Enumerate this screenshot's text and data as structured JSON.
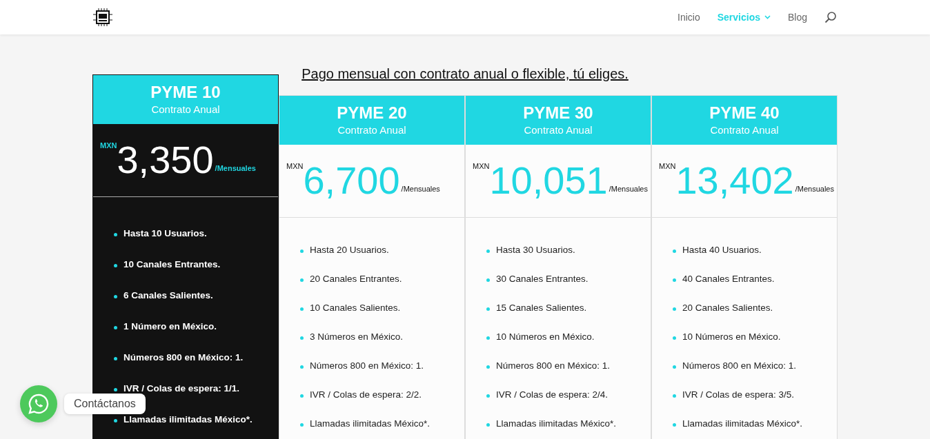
{
  "nav": {
    "items": [
      {
        "label": "Inicio",
        "selected": false,
        "has_menu": false
      },
      {
        "label": "Servicios",
        "selected": true,
        "has_menu": true
      },
      {
        "label": "Blog",
        "selected": false,
        "has_menu": false
      }
    ]
  },
  "heading": "Pago mensual con contrato anual o flexible, tú eliges.",
  "plans": [
    {
      "name": "PYME 10",
      "term": "Contrato Anual",
      "featured": true,
      "currency": "MXN",
      "price": "3,350",
      "period": "/Mensuales",
      "features": [
        "Hasta 10 Usuarios.",
        "10 Canales Entrantes.",
        "6 Canales Salientes.",
        "1 Número en México.",
        "Números 800 en México: 1.",
        "IVR / Colas de espera: 1/1.",
        "Llamadas ilimitadas México*."
      ]
    },
    {
      "name": "PYME 20",
      "term": "Contrato Anual",
      "featured": false,
      "currency": "MXN",
      "price": "6,700",
      "period": "/Mensuales",
      "features": [
        "Hasta 20 Usuarios.",
        "20 Canales Entrantes.",
        "10 Canales Salientes.",
        "3 Números en México.",
        "Números 800 en México: 1.",
        "IVR / Colas de espera: 2/2.",
        "Llamadas ilimitadas México*."
      ]
    },
    {
      "name": "PYME 30",
      "term": "Contrato Anual",
      "featured": false,
      "currency": "MXN",
      "price": "10,051",
      "period": "/Mensuales",
      "features": [
        "Hasta 30 Usuarios.",
        "30 Canales Entrantes.",
        "15 Canales Salientes.",
        "10 Números en México.",
        "Números 800 en México: 1.",
        "IVR / Colas de espera: 2/4.",
        "Llamadas ilimitadas México*."
      ]
    },
    {
      "name": "PYME 40",
      "term": "Contrato Anual",
      "featured": false,
      "currency": "MXN",
      "price": "13,402",
      "period": "/Mensuales",
      "features": [
        "Hasta 40 Usuarios.",
        "40 Canales Entrantes.",
        "20 Canales Salientes.",
        "10 Números en México.",
        "Números 800 en México: 1.",
        "IVR / Colas de espera: 3/5.",
        "Llamadas ilimitadas México*."
      ]
    }
  ],
  "chat": {
    "label": "Contáctanos"
  }
}
